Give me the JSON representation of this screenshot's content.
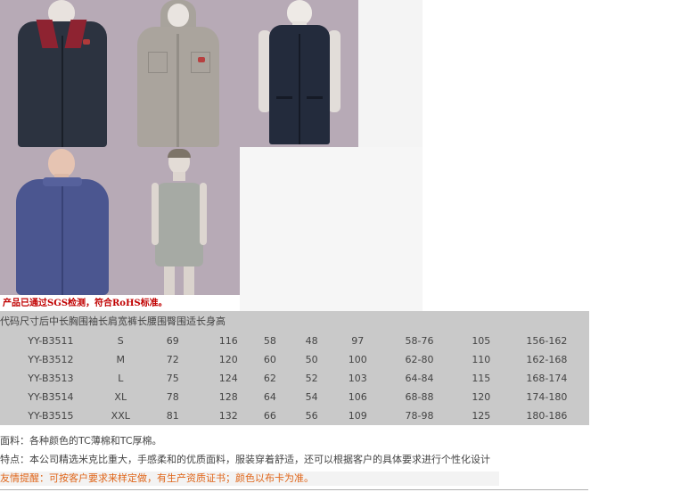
{
  "notice": "产品已通过SGS检测，符合RoHS标准。",
  "size_table": {
    "headers": [
      "代码",
      "尺寸",
      "后中长",
      "胸围",
      "袖长",
      "肩宽",
      "裤长",
      "腰围",
      "臀围",
      "适长身高"
    ],
    "rows": [
      [
        "YY-B3511",
        "S",
        "69",
        "116",
        "58",
        "48",
        "97",
        "58-76",
        "105",
        "156-162"
      ],
      [
        "YY-B3512",
        "M",
        "72",
        "120",
        "60",
        "50",
        "100",
        "62-80",
        "110",
        "162-168"
      ],
      [
        "YY-B3513",
        "L",
        "75",
        "124",
        "62",
        "52",
        "103",
        "64-84",
        "115",
        "168-174"
      ],
      [
        "YY-B3514",
        "XL",
        "78",
        "128",
        "64",
        "54",
        "106",
        "68-88",
        "120",
        "174-180"
      ],
      [
        "YY-B3515",
        "XXL",
        "81",
        "132",
        "66",
        "56",
        "109",
        "78-98",
        "125",
        "180-186"
      ]
    ]
  },
  "fabric": "面料：各种颜色的TC薄棉和TC厚棉。",
  "features": "特点：本公司精选米克比重大，手感柔和的优质面料，服装穿着舒适，还可以根据客户的具体要求进行个性化设计",
  "reminder": "友情提醒：可按客户要求来样定做，有生产资质证书；颜色以布卡为准。",
  "colors": {
    "photo_bg": "#b7aab6",
    "table_bg": "#c9c9c9",
    "notice": "#c00000",
    "reminder": "#e0661a"
  }
}
